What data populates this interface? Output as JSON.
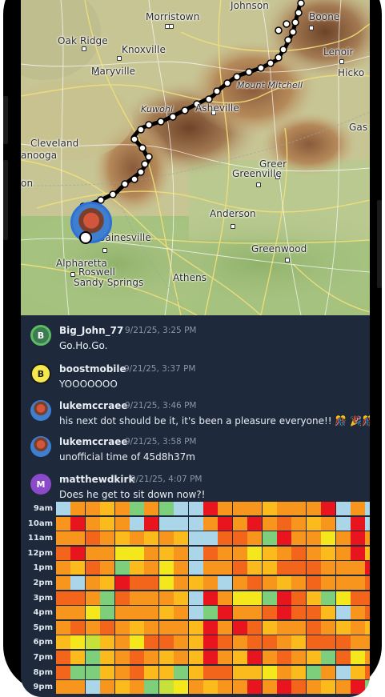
{
  "map": {
    "cities": [
      {
        "name": "Johnson",
        "type": "city"
      },
      {
        "name": "Boone",
        "type": "city"
      },
      {
        "name": "Morristown",
        "type": "city"
      },
      {
        "name": "Oak Ridge",
        "type": "city"
      },
      {
        "name": "Knoxville",
        "type": "city"
      },
      {
        "name": "Lenoir",
        "type": "city"
      },
      {
        "name": "Hicko",
        "type": "city"
      },
      {
        "name": "Maryville",
        "type": "city"
      },
      {
        "name": "Mount Mitchell",
        "type": "peak"
      },
      {
        "name": "Kuwohi",
        "type": "peak"
      },
      {
        "name": "Asheville",
        "type": "city"
      },
      {
        "name": "Gas",
        "type": "city"
      },
      {
        "name": "Cleveland",
        "type": "city"
      },
      {
        "name": "anooga",
        "type": "city"
      },
      {
        "name": "Greer",
        "type": "city"
      },
      {
        "name": "Greenville",
        "type": "city"
      },
      {
        "name": "on",
        "type": "city"
      },
      {
        "name": "Anderson",
        "type": "city"
      },
      {
        "name": "Gainesville",
        "type": "city"
      },
      {
        "name": "Greenwood",
        "type": "city"
      },
      {
        "name": "Alpharetta",
        "type": "city"
      },
      {
        "name": "Roswell",
        "type": "city"
      },
      {
        "name": "Sandy Springs",
        "type": "city"
      },
      {
        "name": "Athens",
        "type": "city"
      }
    ]
  },
  "messages": [
    {
      "user": "Big_John_77",
      "time": "9/21/25, 3:25 PM",
      "text": "Go.Ho.Go.",
      "avatar_letter": "B",
      "avatar_style": "green"
    },
    {
      "user": "boostmobile",
      "time": "9/21/25, 3:37 PM",
      "text": "YOOOOOOO",
      "avatar_letter": "B",
      "avatar_style": "yellow"
    },
    {
      "user": "lukemccraee",
      "time": "9/21/25, 3:46 PM",
      "text": "his next dot should be it, it's been a pleasure everyone!! 🎊 🎉🎊 🎉",
      "avatar_letter": "",
      "avatar_style": "photo"
    },
    {
      "user": "lukemccraee",
      "time": "9/21/25, 3:58 PM",
      "text": "unofficial time of 45d8h37m",
      "avatar_letter": "",
      "avatar_style": "photo"
    },
    {
      "user": "matthewdkirk",
      "time": "9/21/25, 4:07 PM",
      "text": "Does he get to sit down now?!",
      "avatar_letter": "M",
      "avatar_style": "purple"
    }
  ],
  "heatmap": {
    "hours": [
      "9am",
      "10am",
      "11am",
      "12pm",
      "1pm",
      "2pm",
      "3pm",
      "4pm",
      "5pm",
      "6pm",
      "7pm",
      "8pm",
      "9pm"
    ],
    "colors": {
      "r": "#e8151f",
      "o": "#f2651a",
      "O": "#f7951d",
      "a": "#fbbb1c",
      "y": "#f4e81c",
      "g": "#c6e23a",
      "G": "#7dcf7c",
      "b": "#abd5e8"
    },
    "rows": [
      "bOOaOGOGbbrOOOaOOOrbObO",
      "OrOaObrbbbOrOrOoOaObrbO",
      "OOoOaOaOabbooOGrOOyOrOb",
      "orOOyyOaOboOOyaOoOaOraO",
      "OaoOGaOyObOOoaaoooOOOro",
      "ObOarooyOaObOoOaOoOOOoO",
      "ooOGoOOOabrOyyGroaGyooO",
      "OOyGOOOaObGrOOorooabOoa",
      "OoOoOaOOOarOroaOOoOaOaO",
      "aygaOyooOaroOooOaoooOOg",
      "oaGaOoOaOarOarOoOaGoyOa",
      "oGGaOoaaGaooaayOaGObaoo",
      "OObOaOGgyOaOOrOroOaOrGa"
    ]
  }
}
